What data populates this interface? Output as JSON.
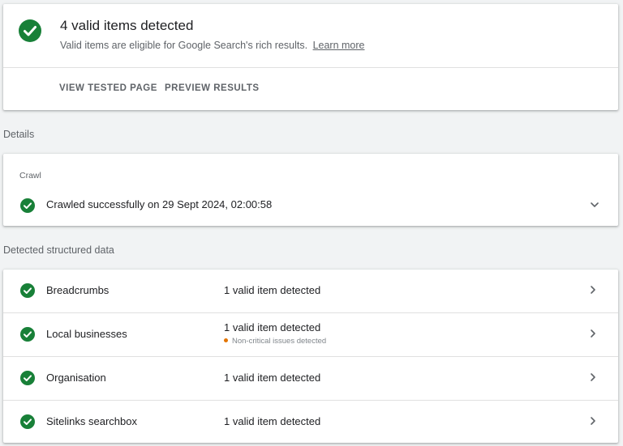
{
  "summary": {
    "title": "4 valid items detected",
    "subtitle": "Valid items are eligible for Google Search's rich results.",
    "learn_more": "Learn more",
    "actions": {
      "view_tested_page": "VIEW TESTED PAGE",
      "preview_results": "PREVIEW RESULTS"
    }
  },
  "details": {
    "section_label": "Details",
    "crawl": {
      "label": "Crawl",
      "status": "Crawled successfully on 29 Sept 2024, 02:00:58"
    }
  },
  "structured_data": {
    "section_label": "Detected structured data",
    "items": [
      {
        "name": "Breadcrumbs",
        "status": "1 valid item detected",
        "note": ""
      },
      {
        "name": "Local businesses",
        "status": "1 valid item detected",
        "note": "Non-critical issues detected"
      },
      {
        "name": "Organisation",
        "status": "1 valid item detected",
        "note": ""
      },
      {
        "name": "Sitelinks searchbox",
        "status": "1 valid item detected",
        "note": ""
      }
    ]
  },
  "icons": {
    "valid": "check-circle-icon",
    "expand": "chevron-down-icon",
    "open": "chevron-right-icon",
    "warning": "warning-dot-icon"
  },
  "colors": {
    "valid_green": "#188038",
    "warning_orange": "#e37400",
    "background": "#f1f3f4"
  }
}
